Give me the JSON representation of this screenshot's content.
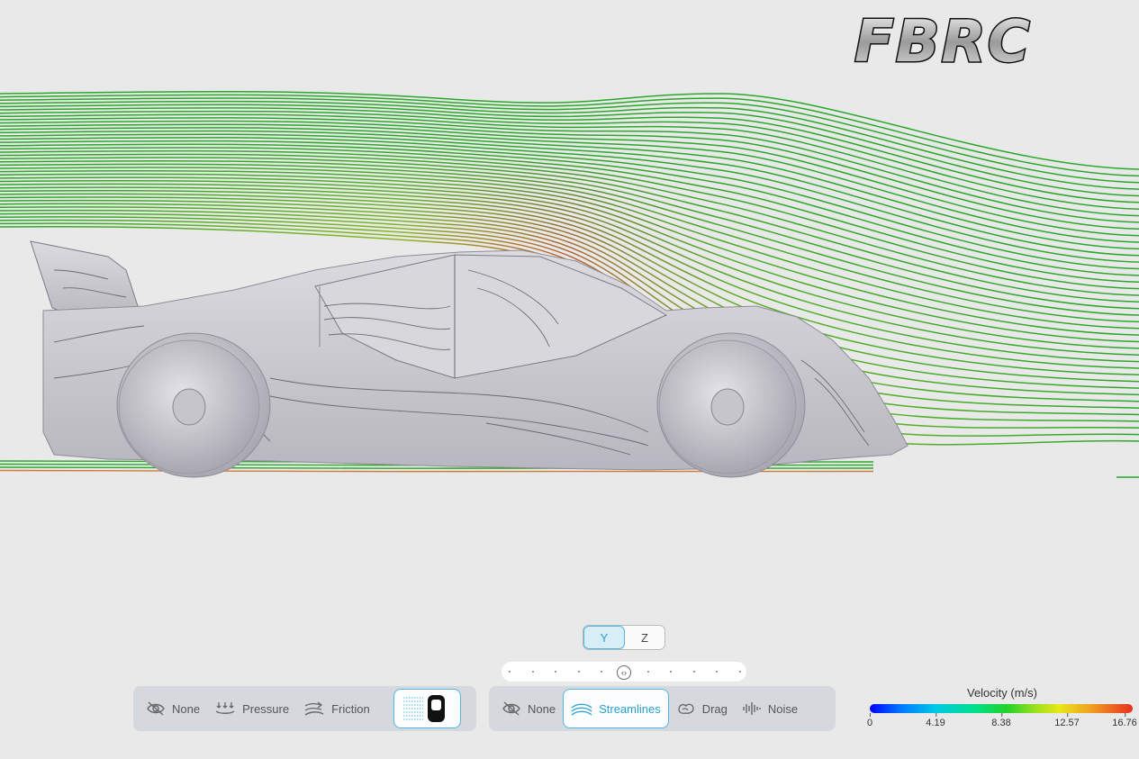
{
  "brand": {
    "logo_text": "FBRC"
  },
  "axis_toggle": {
    "options": [
      "Y",
      "Z"
    ],
    "selected": "Y"
  },
  "slice_slider": {
    "position": 0.5
  },
  "surface_modes": {
    "options": [
      {
        "label": "None",
        "icon": "eye-off-icon"
      },
      {
        "label": "Pressure",
        "icon": "pressure-icon"
      },
      {
        "label": "Friction",
        "icon": "friction-icon"
      }
    ],
    "extra_icon": "streamline-surface-toggle-icon",
    "active": "streamline-surface-toggle"
  },
  "flow_modes": {
    "options": [
      {
        "label": "None",
        "icon": "eye-off-icon"
      },
      {
        "label": "Streamlines",
        "icon": "streamlines-icon"
      },
      {
        "label": "Drag",
        "icon": "drag-icon"
      },
      {
        "label": "Noise",
        "icon": "noise-icon"
      }
    ],
    "active": "Streamlines"
  },
  "legend": {
    "title": "Velocity (m/s)",
    "ticks": [
      "0",
      "4.19",
      "8.38",
      "12.57",
      "16.76"
    ]
  },
  "colors": {
    "accent": "#2a9fd0",
    "car_body": "#cfcdd3",
    "streamline_base": "#2aa82a",
    "streamline_hot": "#e0503a"
  }
}
